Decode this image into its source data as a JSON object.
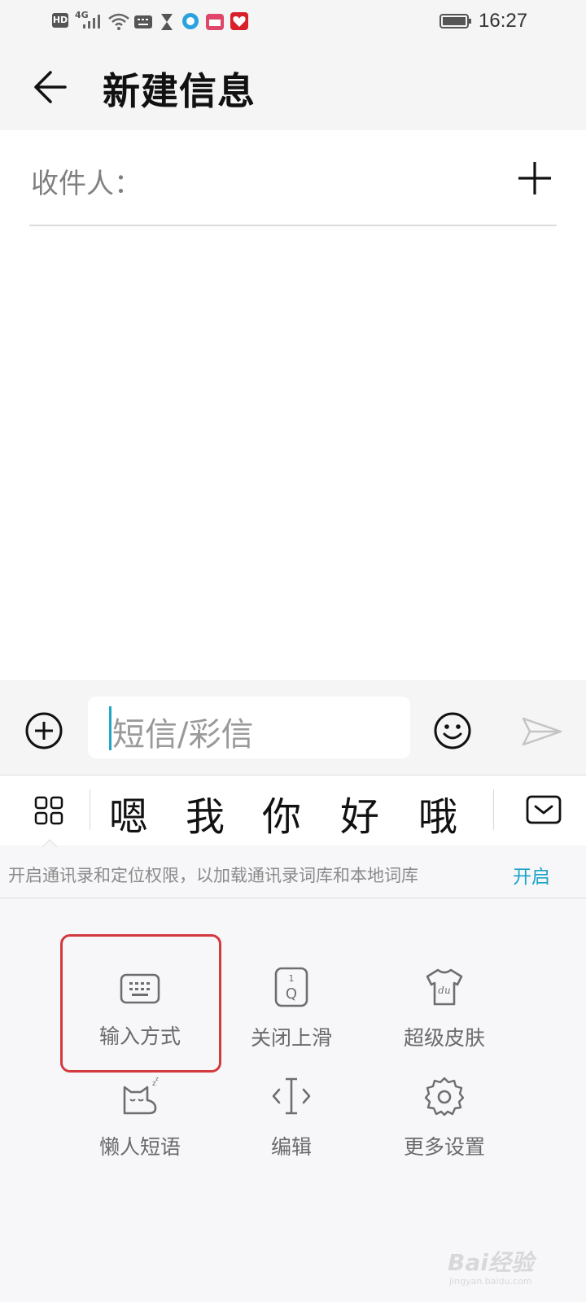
{
  "status_bar": {
    "network_badge": "HD",
    "network_type": "4G",
    "time": "16:27",
    "icons": [
      "hd-icon",
      "signal-icon",
      "wifi-icon",
      "keyboard-icon",
      "hourglass-icon",
      "app-bubble-icon",
      "calendar-icon",
      "heart-icon",
      "battery-icon"
    ]
  },
  "header": {
    "title": "新建信息",
    "back_icon": "arrow-left-icon"
  },
  "recipients": {
    "label": "收件人：",
    "add_icon": "plus-icon"
  },
  "composer": {
    "placeholder": "短信/彩信",
    "attach_icon": "plus-circle-icon",
    "emoji_icon": "smiley-icon",
    "send_icon": "send-icon"
  },
  "candidate_bar": {
    "menu_icon": "grid-icon",
    "candidates": [
      "嗯",
      "我",
      "你",
      "好",
      "哦"
    ],
    "hide_icon": "keyboard-hide-icon"
  },
  "permission_banner": {
    "text": "开启通讯录和定位权限，以加载通讯录词库和本地词库",
    "action": "开启",
    "action_color": "#1ba3c8"
  },
  "keyboard_menu": {
    "items": [
      {
        "label": "输入方式",
        "icon": "keyboard-icon"
      },
      {
        "label": "关闭上滑",
        "icon": "key-q-icon"
      },
      {
        "label": "超级皮肤",
        "icon": "tshirt-icon"
      },
      {
        "label": "懒人短语",
        "icon": "sleepy-cat-icon"
      },
      {
        "label": "编辑",
        "icon": "text-cursor-icon"
      },
      {
        "label": "更多设置",
        "icon": "gear-icon"
      }
    ],
    "highlight_color": "#d23a40"
  },
  "watermark": {
    "text": "Bai经验",
    "subtext": "jingyan.baidu.com"
  }
}
